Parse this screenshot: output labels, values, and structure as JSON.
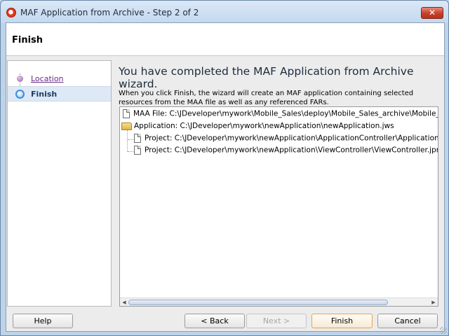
{
  "window": {
    "title": "MAF Application from Archive - Step 2 of 2",
    "close_glyph": "✕"
  },
  "header": {
    "title": "Finish"
  },
  "train": {
    "steps": [
      {
        "label": "Location",
        "state": "visited"
      },
      {
        "label": "Finish",
        "state": "current"
      }
    ]
  },
  "main": {
    "heading": "You have completed the MAF Application from Archive wizard.",
    "description": "When you click Finish, the wizard will create an MAF application containing selected resources from the MAA file as well as any referenced FARs.",
    "tree": [
      {
        "icon": "file-icon",
        "text": "MAA File:  C:\\JDeveloper\\mywork\\Mobile_Sales\\deploy\\Mobile_Sales_archive\\Mobile_Sales"
      },
      {
        "icon": "folder-open-icon",
        "text": "Application: C:\\JDeveloper\\mywork\\newApplication\\newApplication.jws"
      },
      {
        "icon": "file-icon",
        "text": "Project: C:\\JDeveloper\\mywork\\newApplication\\ApplicationController\\ApplicationContr"
      },
      {
        "icon": "file-icon",
        "text": "Project: C:\\JDeveloper\\mywork\\newApplication\\ViewController\\ViewController.jpr"
      }
    ],
    "scroll": {
      "left_glyph": "◀",
      "right_glyph": "▶",
      "position": 0
    }
  },
  "buttons": {
    "help": "Help",
    "back": "< Back",
    "next": "Next >",
    "finish": "Finish",
    "cancel": "Cancel"
  }
}
